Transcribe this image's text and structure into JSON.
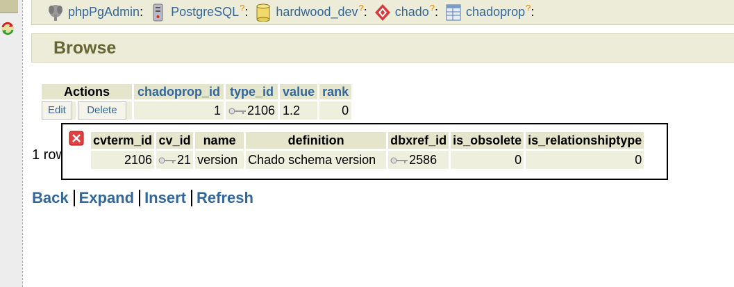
{
  "trail": {
    "items": [
      {
        "label": "phpPgAdmin",
        "icon": "elephant-icon",
        "help": ""
      },
      {
        "label": "PostgreSQL",
        "icon": "server-icon",
        "help": "?"
      },
      {
        "label": "hardwood_dev",
        "icon": "database-icon",
        "help": "?"
      },
      {
        "label": "chado",
        "icon": "schema-icon",
        "help": "?"
      },
      {
        "label": "chadoprop",
        "icon": "table-icon",
        "help": "?"
      }
    ],
    "separator": ":"
  },
  "page": {
    "title": "Browse"
  },
  "table": {
    "actions_header": "Actions",
    "columns": [
      "chadoprop_id",
      "type_id",
      "value",
      "rank"
    ],
    "rows": [
      {
        "edit": "Edit",
        "delete": "Delete",
        "chadoprop_id": "1",
        "type_id": "2106",
        "value": "1.2",
        "rank": "0"
      }
    ]
  },
  "row_count": "1 row",
  "popup": {
    "columns": [
      "cvterm_id",
      "cv_id",
      "name",
      "definition",
      "dbxref_id",
      "is_obsolete",
      "is_relationshiptype"
    ],
    "row": {
      "cvterm_id": "2106",
      "cv_id": "21",
      "name": "version",
      "definition": "Chado schema version",
      "dbxref_id": "2586",
      "is_obsolete": "0",
      "is_relationshiptype": "0"
    }
  },
  "nav": {
    "back": "Back",
    "expand": "Expand",
    "insert": "Insert",
    "refresh": "Refresh"
  },
  "colors": {
    "link": "#336699",
    "title": "#666633",
    "header_bg": "#e5e5cc",
    "cell_bg": "#efefde",
    "bar_bg": "#edecd9"
  }
}
